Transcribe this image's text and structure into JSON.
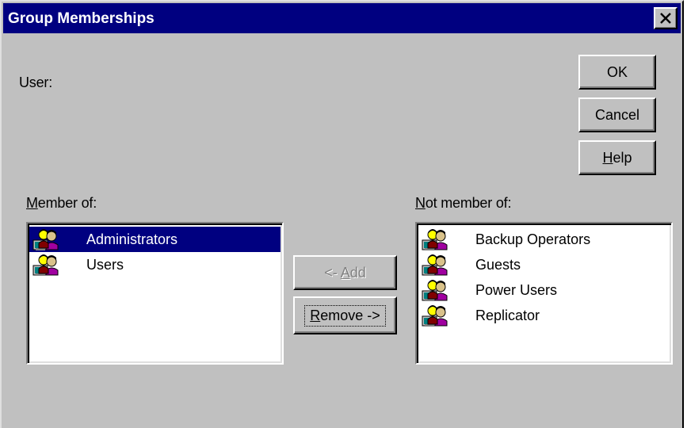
{
  "window": {
    "title": "Group Memberships",
    "close_glyph": "×"
  },
  "user": {
    "label": "User:"
  },
  "buttons": {
    "ok": "OK",
    "cancel": "Cancel",
    "help_mnemonic": "H",
    "help_rest": "elp",
    "add_prefix": "<- ",
    "add_mnemonic": "A",
    "add_rest": "dd",
    "remove_mnemonic": "R",
    "remove_rest": "emove ->"
  },
  "member_of": {
    "label_mnemonic": "M",
    "label_rest": "ember of:",
    "items": [
      {
        "label": "Administrators",
        "icon": "group-icon",
        "selected": true
      },
      {
        "label": "Users",
        "icon": "group-icon",
        "selected": false
      }
    ]
  },
  "not_member_of": {
    "label_mnemonic": "N",
    "label_rest": "ot member of:",
    "items": [
      {
        "label": "Backup Operators",
        "icon": "group-icon",
        "selected": false
      },
      {
        "label": "Guests",
        "icon": "group-icon",
        "selected": false
      },
      {
        "label": "Power Users",
        "icon": "group-icon",
        "selected": false
      },
      {
        "label": "Replicator",
        "icon": "group-icon",
        "selected": false
      }
    ]
  },
  "colors": {
    "title_bar": "#000080",
    "dialog_face": "#c0c0c0",
    "selection": "#000080"
  }
}
